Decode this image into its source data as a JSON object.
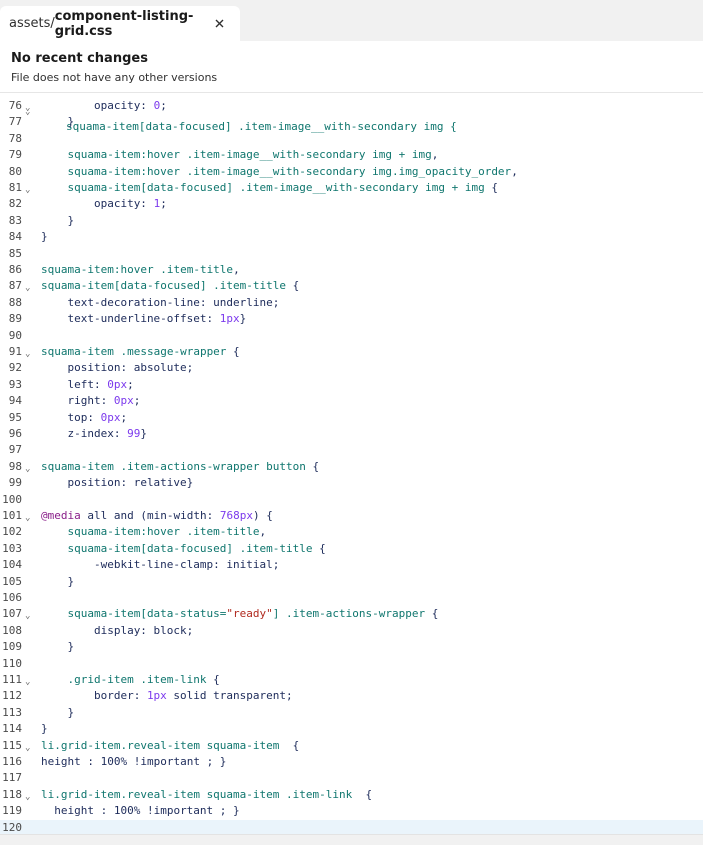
{
  "tab": {
    "path_prefix": "assets/",
    "file_name": "component-listing-grid.css",
    "close_label": "×"
  },
  "info": {
    "title": "No recent changes",
    "subtitle": "File does not have any other versions"
  },
  "colors": {
    "selector": "#0f766e",
    "property": "#1d2b5a",
    "number": "#7c3aed",
    "string": "#b02a1f",
    "at_rule": "#8a1f8a",
    "active_line": "#eaf4fb"
  },
  "editor": {
    "active_line": 120,
    "lines": [
      {
        "n": 76,
        "fold": true,
        "indent": 8,
        "tokens": [
          [
            "p",
            "opacity: "
          ],
          [
            "n",
            "0"
          ],
          [
            "p",
            ";"
          ]
        ]
      },
      {
        "n": 77,
        "fold": false,
        "indent": 4,
        "tokens": [
          [
            "p",
            "}"
          ]
        ]
      },
      {
        "n": 78,
        "fold": false,
        "indent": 0,
        "tokens": []
      },
      {
        "n": 79,
        "fold": false,
        "indent": 4,
        "tokens": [
          [
            "s",
            "squama-item:hover .item-image__with-secondary img + img"
          ],
          [
            "p",
            ","
          ]
        ]
      },
      {
        "n": 80,
        "fold": false,
        "indent": 4,
        "tokens": [
          [
            "s",
            "squama-item:hover .item-image__with-secondary img.img_opacity_order"
          ],
          [
            "p",
            ","
          ]
        ]
      },
      {
        "n": 81,
        "fold": true,
        "indent": 4,
        "tokens": [
          [
            "s",
            "squama-item[data-focused] .item-image__with-secondary img + img"
          ],
          [
            "p",
            " {"
          ]
        ]
      },
      {
        "n": 82,
        "fold": false,
        "indent": 8,
        "tokens": [
          [
            "p",
            "opacity: "
          ],
          [
            "n",
            "1"
          ],
          [
            "p",
            ";"
          ]
        ]
      },
      {
        "n": 83,
        "fold": false,
        "indent": 4,
        "tokens": [
          [
            "p",
            "}"
          ]
        ]
      },
      {
        "n": 84,
        "fold": false,
        "indent": 0,
        "tokens": [
          [
            "p",
            "}"
          ]
        ]
      },
      {
        "n": 85,
        "fold": false,
        "indent": 0,
        "tokens": []
      },
      {
        "n": 86,
        "fold": false,
        "indent": 0,
        "tokens": [
          [
            "s",
            "squama-item:hover .item-title"
          ],
          [
            "p",
            ","
          ]
        ]
      },
      {
        "n": 87,
        "fold": true,
        "indent": 0,
        "tokens": [
          [
            "s",
            "squama-item[data-focused] .item-title"
          ],
          [
            "p",
            " {"
          ]
        ]
      },
      {
        "n": 88,
        "fold": false,
        "indent": 4,
        "tokens": [
          [
            "p",
            "text-decoration-line: underline;"
          ]
        ]
      },
      {
        "n": 89,
        "fold": false,
        "indent": 4,
        "tokens": [
          [
            "p",
            "text-underline-offset: "
          ],
          [
            "n",
            "1px"
          ],
          [
            "p",
            "}"
          ]
        ]
      },
      {
        "n": 90,
        "fold": false,
        "indent": 0,
        "tokens": []
      },
      {
        "n": 91,
        "fold": true,
        "indent": 0,
        "tokens": [
          [
            "s",
            "squama-item .message-wrapper"
          ],
          [
            "p",
            " {"
          ]
        ]
      },
      {
        "n": 92,
        "fold": false,
        "indent": 4,
        "tokens": [
          [
            "p",
            "position: absolute;"
          ]
        ]
      },
      {
        "n": 93,
        "fold": false,
        "indent": 4,
        "tokens": [
          [
            "p",
            "left: "
          ],
          [
            "n",
            "0px"
          ],
          [
            "p",
            ";"
          ]
        ]
      },
      {
        "n": 94,
        "fold": false,
        "indent": 4,
        "tokens": [
          [
            "p",
            "right: "
          ],
          [
            "n",
            "0px"
          ],
          [
            "p",
            ";"
          ]
        ]
      },
      {
        "n": 95,
        "fold": false,
        "indent": 4,
        "tokens": [
          [
            "p",
            "top: "
          ],
          [
            "n",
            "0px"
          ],
          [
            "p",
            ";"
          ]
        ]
      },
      {
        "n": 96,
        "fold": false,
        "indent": 4,
        "tokens": [
          [
            "p",
            "z-index: "
          ],
          [
            "n",
            "99"
          ],
          [
            "p",
            "}"
          ]
        ]
      },
      {
        "n": 97,
        "fold": false,
        "indent": 0,
        "tokens": []
      },
      {
        "n": 98,
        "fold": true,
        "indent": 0,
        "tokens": [
          [
            "s",
            "squama-item .item-actions-wrapper button"
          ],
          [
            "p",
            " {"
          ]
        ]
      },
      {
        "n": 99,
        "fold": false,
        "indent": 4,
        "tokens": [
          [
            "p",
            "position: relative}"
          ]
        ]
      },
      {
        "n": 100,
        "fold": false,
        "indent": 0,
        "tokens": []
      },
      {
        "n": 101,
        "fold": true,
        "indent": 0,
        "tokens": [
          [
            "k",
            "@media"
          ],
          [
            "p",
            " all and (min-width: "
          ],
          [
            "n",
            "768px"
          ],
          [
            "p",
            ") {"
          ]
        ]
      },
      {
        "n": 102,
        "fold": false,
        "indent": 4,
        "tokens": [
          [
            "s",
            "squama-item:hover .item-title"
          ],
          [
            "p",
            ","
          ]
        ]
      },
      {
        "n": 103,
        "fold": false,
        "indent": 4,
        "tokens": [
          [
            "s",
            "squama-item[data-focused] .item-title"
          ],
          [
            "p",
            " {"
          ]
        ]
      },
      {
        "n": 104,
        "fold": false,
        "indent": 8,
        "tokens": [
          [
            "p",
            "-webkit-line-clamp: initial;"
          ]
        ]
      },
      {
        "n": 105,
        "fold": false,
        "indent": 4,
        "tokens": [
          [
            "p",
            "}"
          ]
        ]
      },
      {
        "n": 106,
        "fold": false,
        "indent": 0,
        "tokens": []
      },
      {
        "n": 107,
        "fold": true,
        "indent": 4,
        "tokens": [
          [
            "s",
            "squama-item[data-status="
          ],
          [
            "t",
            "\"ready\""
          ],
          [
            "s",
            "] .item-actions-wrapper"
          ],
          [
            "p",
            " {"
          ]
        ]
      },
      {
        "n": 108,
        "fold": false,
        "indent": 8,
        "tokens": [
          [
            "p",
            "display: block;"
          ]
        ]
      },
      {
        "n": 109,
        "fold": false,
        "indent": 4,
        "tokens": [
          [
            "p",
            "}"
          ]
        ]
      },
      {
        "n": 110,
        "fold": false,
        "indent": 0,
        "tokens": []
      },
      {
        "n": 111,
        "fold": true,
        "indent": 4,
        "tokens": [
          [
            "s",
            ".grid-item .item-link"
          ],
          [
            "p",
            " {"
          ]
        ]
      },
      {
        "n": 112,
        "fold": false,
        "indent": 8,
        "tokens": [
          [
            "p",
            "border: "
          ],
          [
            "n",
            "1px"
          ],
          [
            "p",
            " solid transparent;"
          ]
        ]
      },
      {
        "n": 113,
        "fold": false,
        "indent": 4,
        "tokens": [
          [
            "p",
            "}"
          ]
        ]
      },
      {
        "n": 114,
        "fold": false,
        "indent": 0,
        "tokens": [
          [
            "p",
            "}"
          ]
        ]
      },
      {
        "n": 115,
        "fold": true,
        "indent": 0,
        "tokens": [
          [
            "s",
            "li.grid-item.reveal-item squama-item"
          ],
          [
            "p",
            "  {"
          ]
        ]
      },
      {
        "n": 116,
        "fold": false,
        "indent": 0,
        "tokens": [
          [
            "p",
            "height : 100% !important ; }"
          ]
        ]
      },
      {
        "n": 117,
        "fold": false,
        "indent": 0,
        "tokens": []
      },
      {
        "n": 118,
        "fold": true,
        "indent": 0,
        "tokens": [
          [
            "s",
            "li.grid-item.reveal-item squama-item .item-link"
          ],
          [
            "p",
            "  {"
          ]
        ]
      },
      {
        "n": 119,
        "fold": false,
        "indent": 2,
        "tokens": [
          [
            "p",
            "height : 100% !important ; }"
          ]
        ]
      },
      {
        "n": 120,
        "fold": false,
        "indent": 0,
        "tokens": []
      }
    ]
  }
}
